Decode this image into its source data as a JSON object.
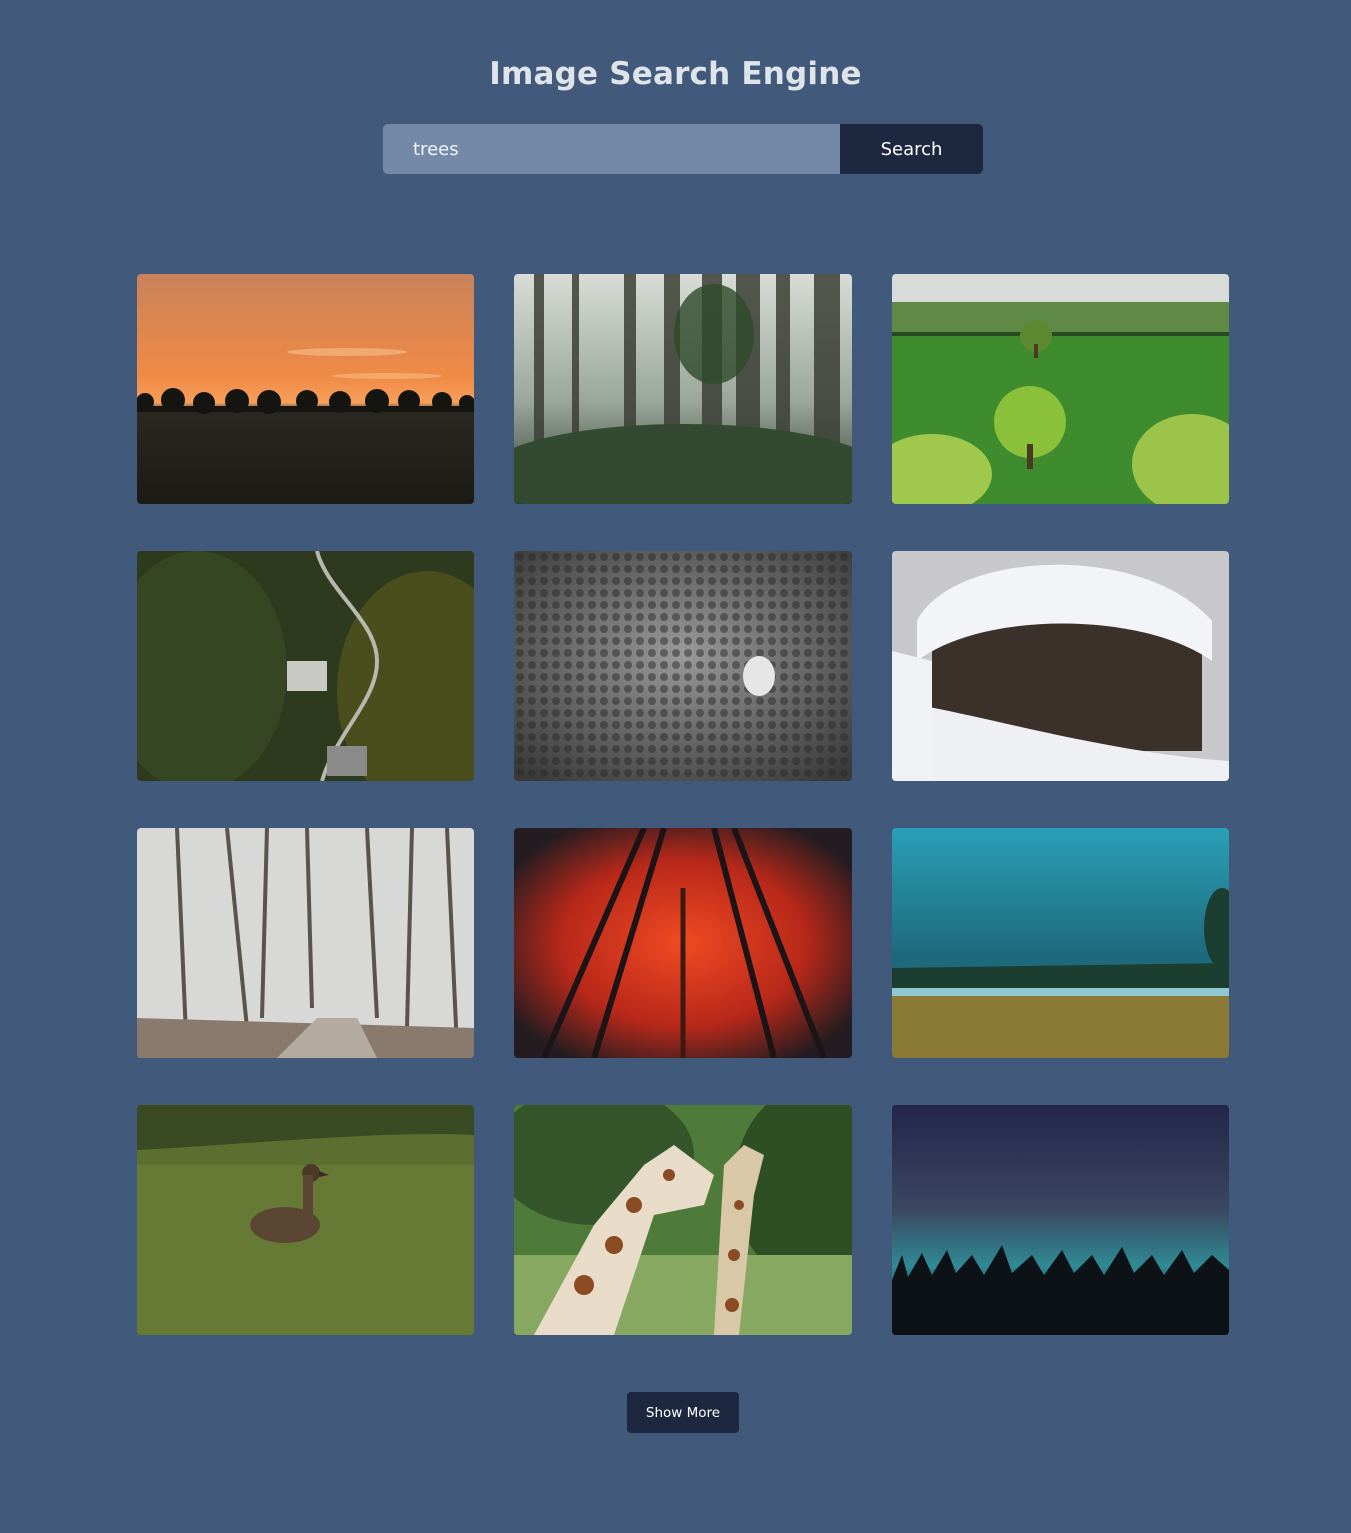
{
  "header": {
    "title": "Image Search Engine"
  },
  "search": {
    "value": "trees",
    "button_label": "Search"
  },
  "results": [
    {
      "subject": "sunset-tree-line-field"
    },
    {
      "subject": "misty-forest"
    },
    {
      "subject": "green-meadow-trees"
    },
    {
      "subject": "aerial-forest-valley-road"
    },
    {
      "subject": "black-white-aerial-forest"
    },
    {
      "subject": "snow-covered-cabin"
    },
    {
      "subject": "frosty-winter-forest-path"
    },
    {
      "subject": "red-autumn-forest-canopy"
    },
    {
      "subject": "teal-mountain-forest-lake"
    },
    {
      "subject": "duck-on-grass"
    },
    {
      "subject": "giraffes-in-trees"
    },
    {
      "subject": "twilight-forest-silhouette"
    }
  ],
  "pagination": {
    "show_more_label": "Show More"
  },
  "colors": {
    "page_background": "#41597a",
    "input_background": "#7489a8",
    "button_background": "#1d2840",
    "title_text": "#dfe4ea"
  }
}
